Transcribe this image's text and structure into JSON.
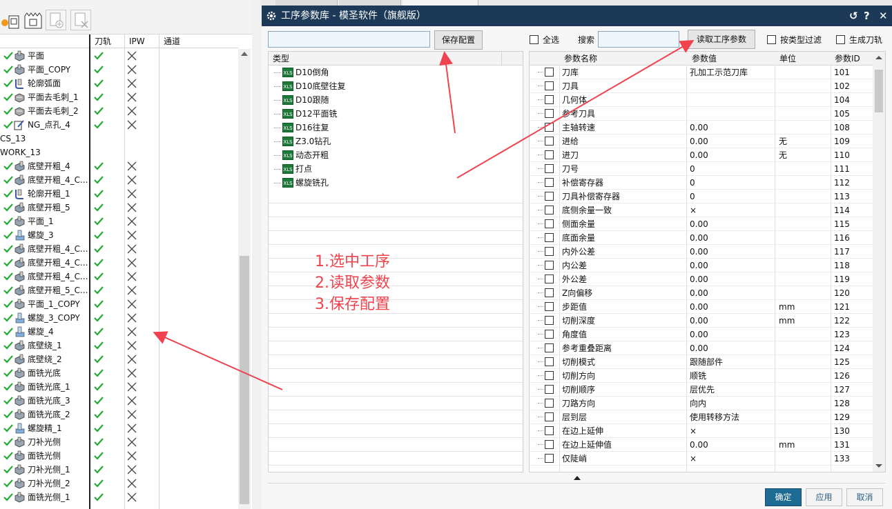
{
  "left_panel": {
    "columns": {
      "toolpath": "刀轨",
      "ipw": "IPW",
      "channel": "通道"
    },
    "rows": [
      {
        "name": "平面",
        "check": true,
        "tp": true,
        "ipw": true,
        "icon": "face-mill-icon"
      },
      {
        "name": "平面_COPY",
        "check": true,
        "tp": true,
        "ipw": true,
        "icon": "face-mill-icon"
      },
      {
        "name": "轮廓弧面",
        "check": true,
        "tp": true,
        "ipw": true,
        "icon": "contour-icon"
      },
      {
        "name": "平面去毛刺_1",
        "check": true,
        "tp": true,
        "ipw": true,
        "icon": "deburr-icon"
      },
      {
        "name": "平面去毛刺_2",
        "check": true,
        "tp": true,
        "ipw": true,
        "icon": "deburr-icon"
      },
      {
        "name": "NG_点孔_4",
        "check": true,
        "tp": true,
        "ipw": true,
        "icon": "spot-drill-icon"
      },
      {
        "name": "CS_13",
        "group": true
      },
      {
        "name": "WORK_13",
        "group": true
      },
      {
        "name": "底壁开粗_4",
        "check": true,
        "tp": true,
        "ipw": true,
        "icon": "floor-wall-icon"
      },
      {
        "name": "底壁开粗_4_C...",
        "check": true,
        "tp": true,
        "ipw": true,
        "icon": "floor-wall-icon"
      },
      {
        "name": "轮廓开粗_1",
        "check": true,
        "tp": true,
        "ipw": true,
        "icon": "contour-icon"
      },
      {
        "name": "底壁开粗_5",
        "check": true,
        "tp": true,
        "ipw": true,
        "icon": "floor-wall-icon"
      },
      {
        "name": "平面_1",
        "check": true,
        "tp": true,
        "ipw": true,
        "icon": "face-mill-icon"
      },
      {
        "name": "螺旋_3",
        "check": true,
        "tp": true,
        "ipw": true,
        "icon": "helix-icon"
      },
      {
        "name": "底壁开粗_4_C...",
        "check": true,
        "tp": true,
        "ipw": true,
        "icon": "floor-wall-icon"
      },
      {
        "name": "底壁开粗_4_C...",
        "check": true,
        "tp": true,
        "ipw": true,
        "icon": "floor-wall-icon"
      },
      {
        "name": "底壁开粗_4_C...",
        "check": true,
        "tp": true,
        "ipw": true,
        "icon": "floor-wall-icon"
      },
      {
        "name": "底壁开粗_5_C...",
        "check": true,
        "tp": true,
        "ipw": true,
        "icon": "floor-wall-icon"
      },
      {
        "name": "平面_1_COPY",
        "check": true,
        "tp": true,
        "ipw": true,
        "icon": "face-mill-icon"
      },
      {
        "name": "螺旋_3_COPY",
        "check": true,
        "tp": true,
        "ipw": true,
        "icon": "helix-icon"
      },
      {
        "name": "螺旋_4",
        "check": true,
        "tp": true,
        "ipw": true,
        "icon": "helix-icon"
      },
      {
        "name": "底壁绕_1",
        "check": true,
        "tp": true,
        "ipw": true,
        "icon": "floor-wall-icon"
      },
      {
        "name": "底壁绕_2",
        "check": true,
        "tp": true,
        "ipw": true,
        "icon": "floor-wall-icon"
      },
      {
        "name": "面铣光底",
        "check": true,
        "tp": true,
        "ipw": true,
        "icon": "face-mill-icon"
      },
      {
        "name": "面铣光底_1",
        "check": true,
        "tp": true,
        "ipw": true,
        "icon": "face-mill-icon"
      },
      {
        "name": "面铣光底_3",
        "check": true,
        "tp": true,
        "ipw": true,
        "icon": "face-mill-icon"
      },
      {
        "name": "面铣光底_2",
        "check": true,
        "tp": true,
        "ipw": true,
        "icon": "face-mill-icon"
      },
      {
        "name": "螺旋精_1",
        "check": true,
        "tp": true,
        "ipw": true,
        "icon": "helix-icon"
      },
      {
        "name": "刀补光侧",
        "check": true,
        "tp": true,
        "ipw": true,
        "icon": "face-mill-icon"
      },
      {
        "name": "面铣光侧",
        "check": true,
        "tp": true,
        "ipw": true,
        "icon": "face-mill-icon"
      },
      {
        "name": "刀补光侧_1",
        "check": true,
        "tp": true,
        "ipw": true,
        "icon": "face-mill-icon"
      },
      {
        "name": "刀补光侧_2",
        "check": true,
        "tp": true,
        "ipw": true,
        "icon": "face-mill-icon"
      },
      {
        "name": "面铣光侧_1",
        "check": true,
        "tp": true,
        "ipw": true,
        "icon": "face-mill-icon"
      }
    ]
  },
  "dialog": {
    "title": "工序参数库 - 模圣软件（旗舰版）",
    "title_buttons": {
      "reset": "↺",
      "help": "?",
      "close": "✕"
    },
    "config_input": {
      "value": "",
      "placeholder": ""
    },
    "save_config_label": "保存配置",
    "select_all_label": "全选",
    "search_label": "搜索",
    "search_input": {
      "value": "",
      "placeholder": ""
    },
    "read_params_label": "读取工序参数",
    "filter_by_type_label": "按类型过滤",
    "generate_toolpath_label": "生成刀轨",
    "type_header": "类型",
    "types": [
      "D10倒角",
      "D10底壁往复",
      "D10跟随",
      "D12平面铣",
      "D16往复",
      "Z3.0钻孔",
      "动态开粗",
      "打点",
      "螺旋铣孔"
    ],
    "param_headers": {
      "name": "参数名称",
      "value": "参数值",
      "unit": "单位",
      "id": "参数ID"
    },
    "params": [
      {
        "name": "刀库",
        "value": "孔加工示范刀库",
        "unit": "",
        "id": "101"
      },
      {
        "name": "刀具",
        "value": "",
        "unit": "",
        "id": "102"
      },
      {
        "name": "几何体",
        "value": "",
        "unit": "",
        "id": "104"
      },
      {
        "name": "参考刀具",
        "value": "",
        "unit": "",
        "id": "105"
      },
      {
        "name": "主轴转速",
        "value": "0.00",
        "unit": "",
        "id": "108"
      },
      {
        "name": "进给",
        "value": "0.00",
        "unit": "无",
        "id": "109"
      },
      {
        "name": "进刀",
        "value": "0.00",
        "unit": "无",
        "id": "110"
      },
      {
        "name": "刀号",
        "value": "0",
        "unit": "",
        "id": "111"
      },
      {
        "name": "补偿寄存器",
        "value": "0",
        "unit": "",
        "id": "112"
      },
      {
        "name": "刀具补偿寄存器",
        "value": "0",
        "unit": "",
        "id": "113"
      },
      {
        "name": "底侧余量一致",
        "value": "×",
        "unit": "",
        "id": "114"
      },
      {
        "name": "侧面余量",
        "value": "0.00",
        "unit": "",
        "id": "115"
      },
      {
        "name": "底面余量",
        "value": "0.00",
        "unit": "",
        "id": "116"
      },
      {
        "name": "内外公差",
        "value": "0.00",
        "unit": "",
        "id": "117"
      },
      {
        "name": "内公差",
        "value": "0.00",
        "unit": "",
        "id": "118"
      },
      {
        "name": "外公差",
        "value": "0.00",
        "unit": "",
        "id": "119"
      },
      {
        "name": "Z向偏移",
        "value": "0.00",
        "unit": "",
        "id": "120"
      },
      {
        "name": "步距值",
        "value": "0.00",
        "unit": "mm",
        "id": "121"
      },
      {
        "name": "切削深度",
        "value": "0.00",
        "unit": "mm",
        "id": "122"
      },
      {
        "name": "角度值",
        "value": "0.00",
        "unit": "",
        "id": "123"
      },
      {
        "name": "参考重叠距离",
        "value": "0.00",
        "unit": "",
        "id": "124"
      },
      {
        "name": "切削模式",
        "value": "跟随部件",
        "unit": "",
        "id": "125"
      },
      {
        "name": "切削方向",
        "value": "顺铣",
        "unit": "",
        "id": "126"
      },
      {
        "name": "切削顺序",
        "value": "层优先",
        "unit": "",
        "id": "127"
      },
      {
        "name": "刀路方向",
        "value": "向内",
        "unit": "",
        "id": "128"
      },
      {
        "name": "层到层",
        "value": "使用转移方法",
        "unit": "",
        "id": "129"
      },
      {
        "name": "在边上延伸",
        "value": "×",
        "unit": "",
        "id": "130"
      },
      {
        "name": "在边上延伸值",
        "value": "0.00",
        "unit": "mm",
        "id": "131"
      },
      {
        "name": "仅陡峭",
        "value": "×",
        "unit": "",
        "id": "133"
      }
    ],
    "ok_label": "确定",
    "apply_label": "应用",
    "cancel_label": "取消"
  },
  "annotation": {
    "lines": [
      "1.选中工序",
      "2.读取参数",
      "3.保存配置"
    ],
    "color": "#f0434d"
  },
  "colors": {
    "title_bar": "#1c3a57",
    "check_green": "#22aa33",
    "primary_button": "#1e6b93"
  }
}
